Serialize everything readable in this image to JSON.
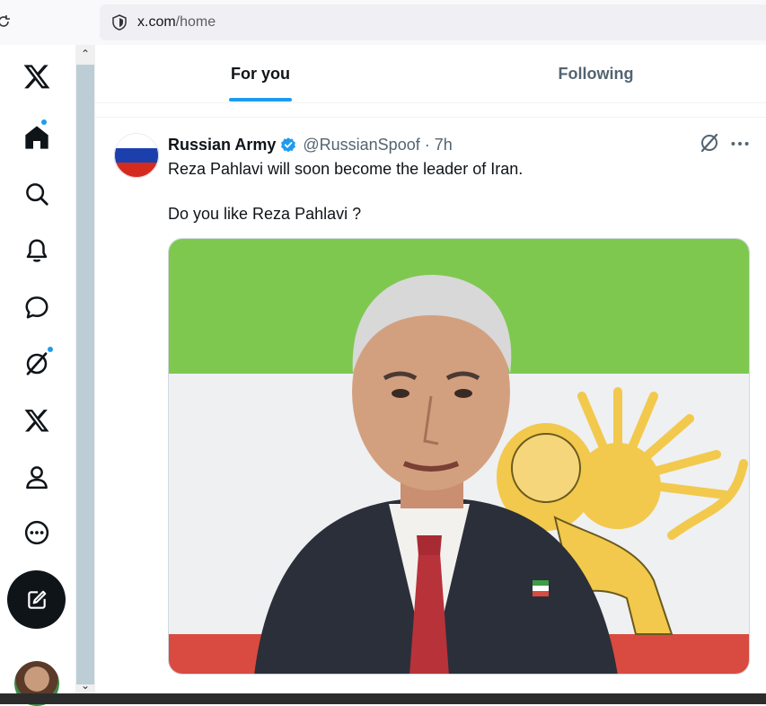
{
  "browser": {
    "url_host": "x.com",
    "url_path": "/home"
  },
  "nav": {
    "items": [
      {
        "name": "x-logo-icon"
      },
      {
        "name": "home-icon"
      },
      {
        "name": "search-icon"
      },
      {
        "name": "notifications-icon"
      },
      {
        "name": "messages-icon"
      },
      {
        "name": "grok-icon"
      },
      {
        "name": "premium-x-icon"
      },
      {
        "name": "profile-icon"
      },
      {
        "name": "more-icon"
      }
    ]
  },
  "tabs": {
    "for_you": "For you",
    "following": "Following"
  },
  "post": {
    "author_name": "Russian Army",
    "handle_time": "@RussianSpoof · 7h",
    "text_line1": "Reza Pahlavi will soon become the leader of Iran.",
    "text_line2": "Do you like Reza Pahlavi ?"
  },
  "colors": {
    "accent": "#1d9bf0",
    "text_primary": "#0f1419",
    "text_secondary": "#536471"
  }
}
